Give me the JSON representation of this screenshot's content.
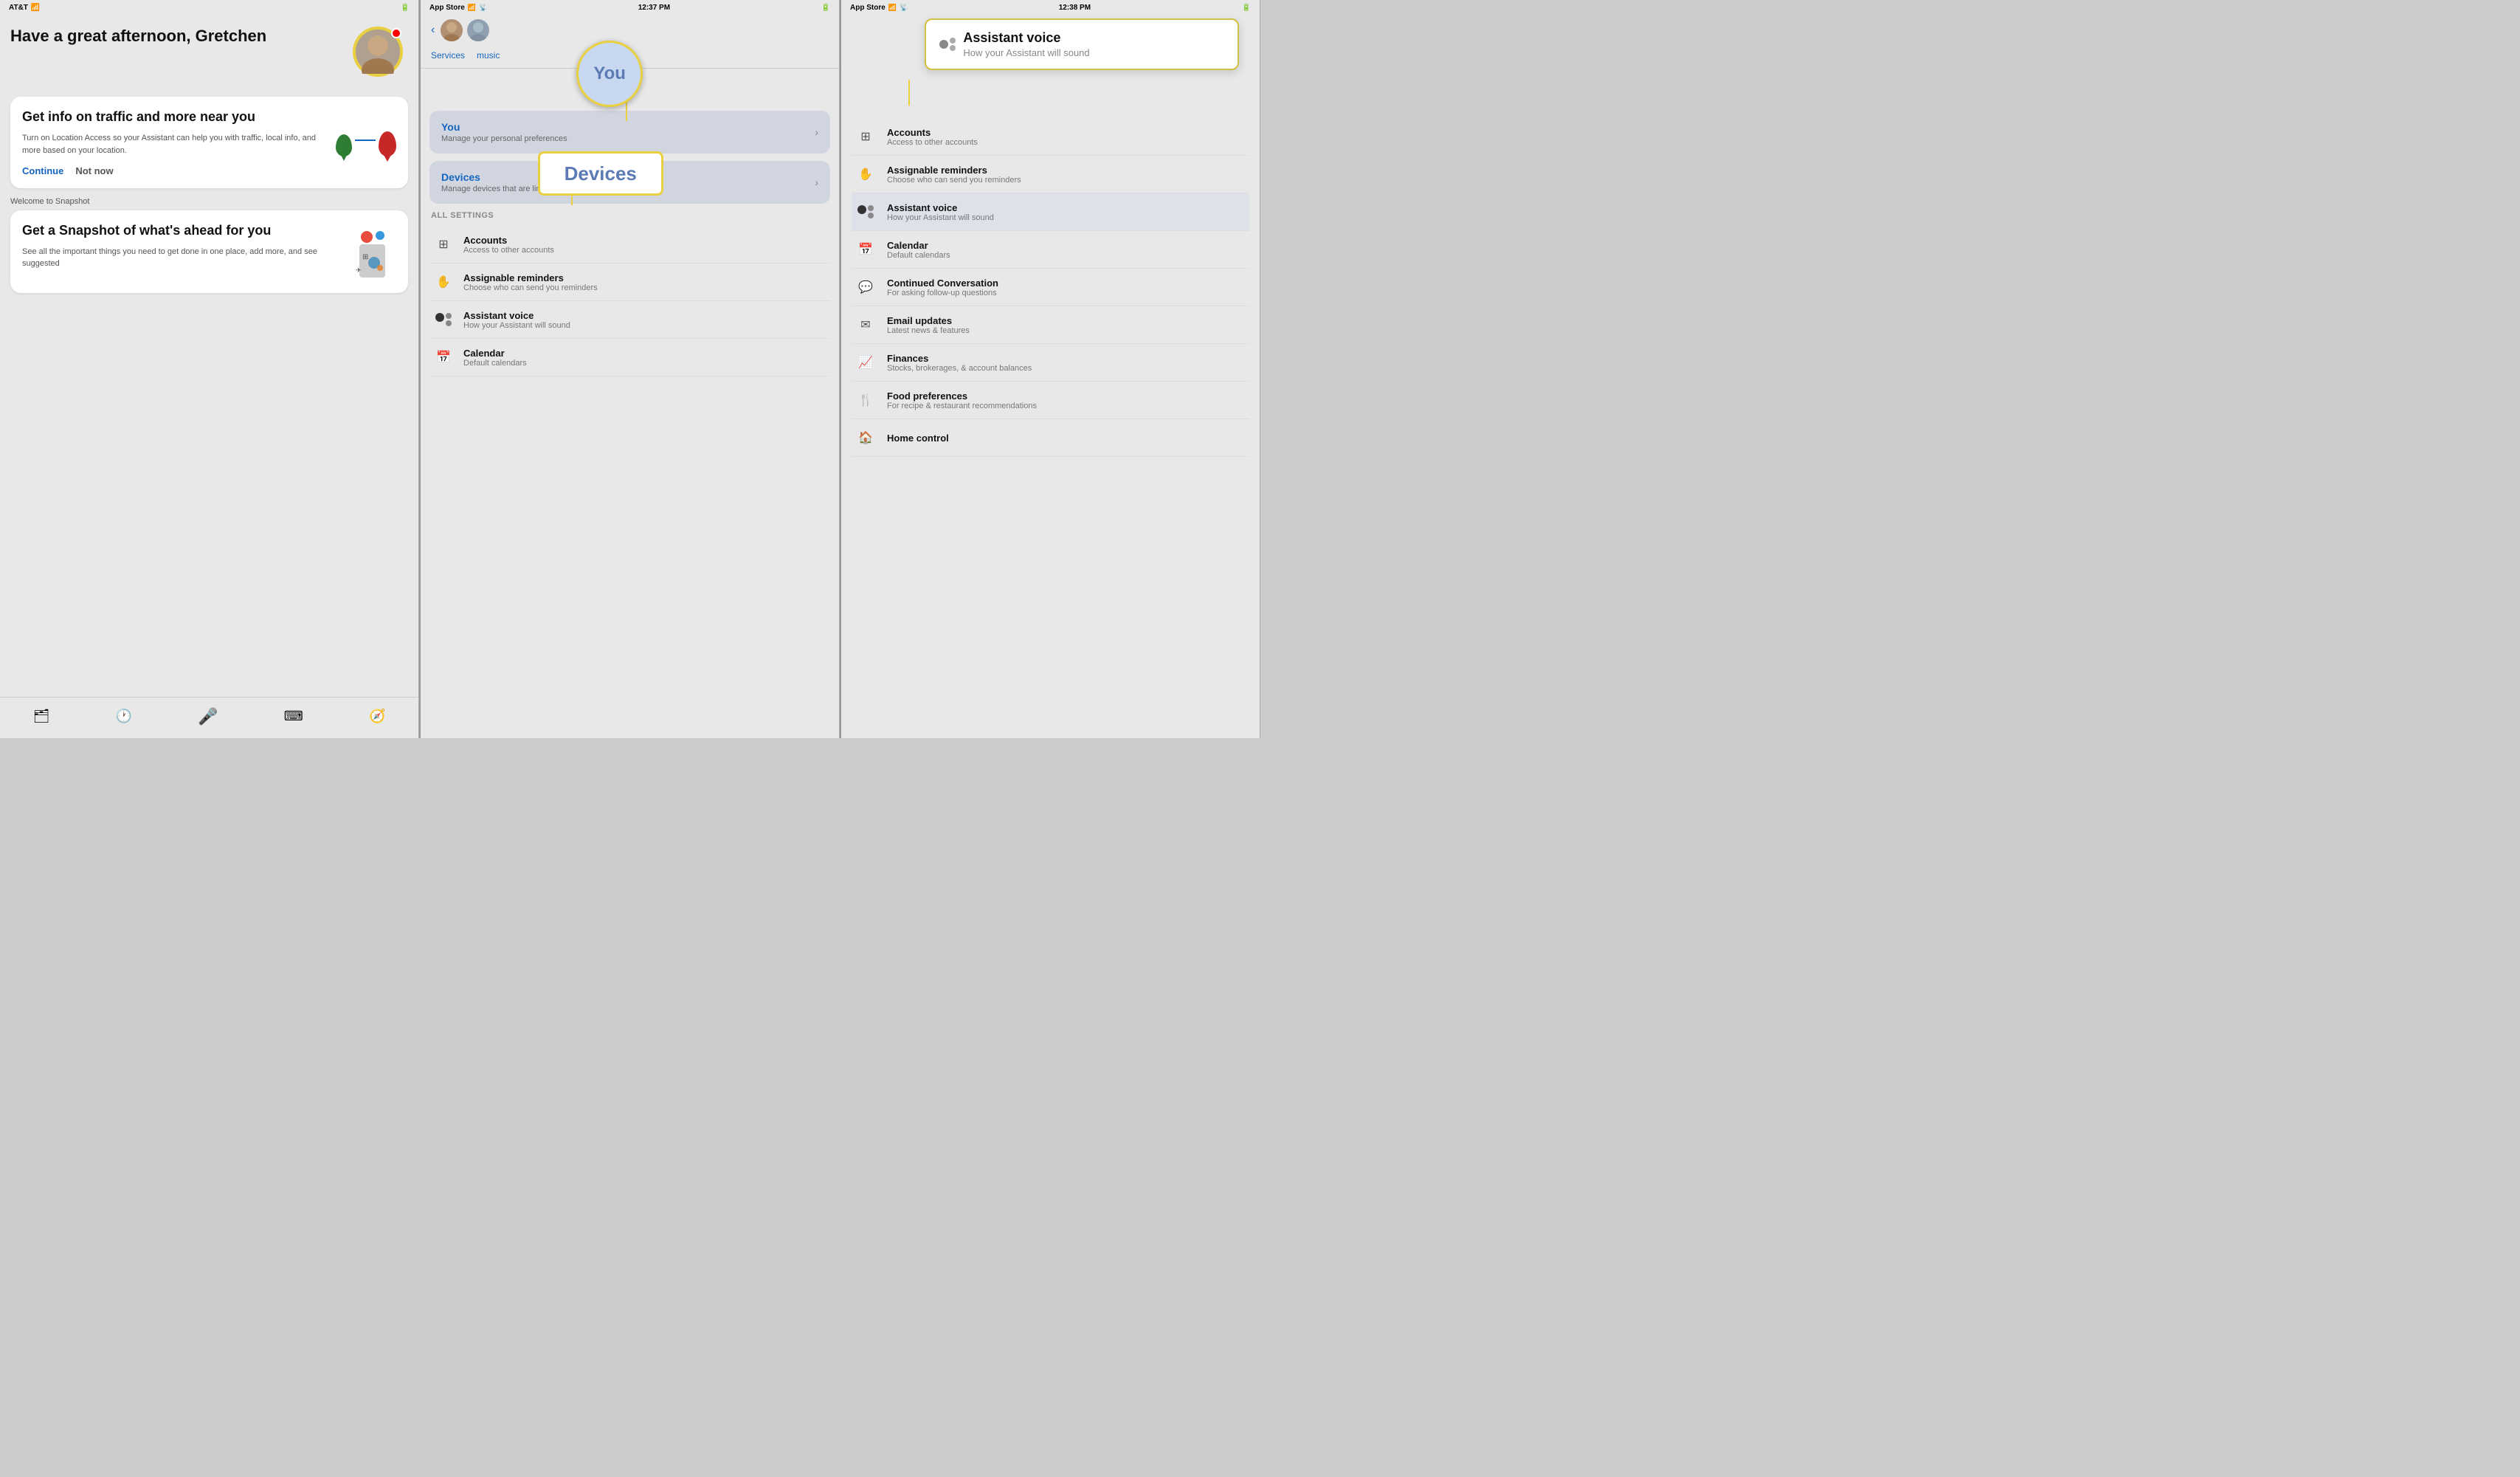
{
  "panels": {
    "panel1": {
      "statusBar": {
        "carrier": "AT&T",
        "time": "",
        "battery": "●●●"
      },
      "greeting": "Have a great afternoon, Gretchen",
      "locationCard": {
        "title": "Get info on traffic and more near you",
        "body": "Turn on Location Access so your Assistant can help you with traffic, local info, and more based on your location.",
        "continueLabel": "Continue",
        "notNowLabel": "Not now"
      },
      "snapshotLabel": "Welcome to Snapshot",
      "snapshotCard": {
        "title": "Get a Snapshot of what's ahead for you",
        "body": "See all the important things you need to get done in one place, add more, and see suggested"
      },
      "bottomNav": {
        "items": [
          "🗂",
          "🕐",
          "🎤",
          "⌨",
          "🧭"
        ]
      }
    },
    "panel2": {
      "statusBar": {
        "carrier": "App Store",
        "time": "12:37 PM"
      },
      "annotation": {
        "you": "You",
        "devices": "Devices"
      },
      "sections": {
        "you": {
          "title": "You",
          "subtitle": "Manage your personal preferences"
        },
        "devices": {
          "title": "Devices",
          "subtitle": "Manage devices that are linked to your Assistant"
        }
      },
      "allSettings": "ALL SETTINGS",
      "settingsItems": [
        {
          "title": "Accounts",
          "subtitle": "Access to other accounts",
          "icon": "accounts"
        },
        {
          "title": "Assignable reminders",
          "subtitle": "Choose who can send you reminders",
          "icon": "reminder"
        },
        {
          "title": "Assistant voice",
          "subtitle": "How your Assistant will sound",
          "icon": "voice"
        },
        {
          "title": "Calendar",
          "subtitle": "Default calendars",
          "icon": "calendar"
        }
      ]
    },
    "panel3": {
      "statusBar": {
        "carrier": "App Store",
        "time": "12:38 PM"
      },
      "tooltip": {
        "title": "Assistant voice",
        "subtitle": "How your Assistant will sound"
      },
      "settingsItems": [
        {
          "title": "Accounts",
          "subtitle": "Access to other accounts",
          "icon": "accounts"
        },
        {
          "title": "Assignable reminders",
          "subtitle": "Choose who can send you reminders",
          "icon": "reminder"
        },
        {
          "title": "Assistant voice",
          "subtitle": "How your Assistant will sound",
          "icon": "voice",
          "highlighted": true
        },
        {
          "title": "Calendar",
          "subtitle": "Default calendars",
          "icon": "calendar"
        },
        {
          "title": "Continued Conversation",
          "subtitle": "For asking follow-up questions",
          "icon": "chat"
        },
        {
          "title": "Email updates",
          "subtitle": "Latest news & features",
          "icon": "email"
        },
        {
          "title": "Finances",
          "subtitle": "Stocks, brokerages, & account balances",
          "icon": "finance"
        },
        {
          "title": "Food preferences",
          "subtitle": "For recipe & restaurant recommendations",
          "icon": "food"
        },
        {
          "title": "Home control",
          "subtitle": "",
          "icon": "home"
        }
      ]
    }
  }
}
